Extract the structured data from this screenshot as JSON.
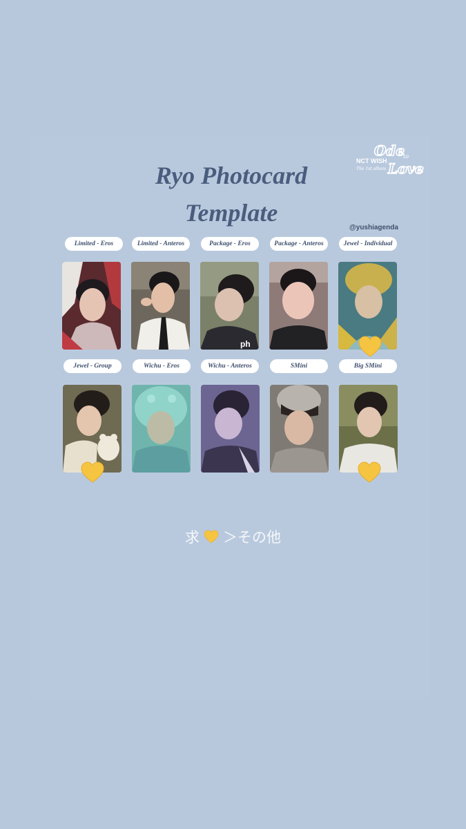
{
  "title_line1": "Ryo Photocard",
  "title_line2": "Template",
  "handle": "@yushiagenda",
  "logo": {
    "text_main": "Ode to Love",
    "text_sub": "NCT WISH",
    "text_sub2": "The 1st album"
  },
  "row1": [
    {
      "label": "Limited - Eros",
      "photo": "portrait-red-hood",
      "heart": false
    },
    {
      "label": "Limited - Anteros",
      "photo": "portrait-white-shirt-tie",
      "heart": false
    },
    {
      "label": "Package - Eros",
      "photo": "portrait-closeup-green",
      "heart": false
    },
    {
      "label": "Package - Anteros",
      "photo": "portrait-black-top",
      "heart": false
    },
    {
      "label": "Jewel - Individual",
      "photo": "portrait-yellow-hat",
      "heart": true
    }
  ],
  "row2": [
    {
      "label": "Jewel - Group",
      "photo": "portrait-with-bear",
      "heart": true
    },
    {
      "label": "Wichu - Eros",
      "photo": "portrait-teal-hood",
      "heart": false
    },
    {
      "label": "Wichu - Anteros",
      "photo": "portrait-purple-dark",
      "heart": false
    },
    {
      "label": "SMini",
      "photo": "portrait-grey-beanie",
      "heart": false
    },
    {
      "label": "Big SMini",
      "photo": "portrait-outdoor",
      "heart": true
    }
  ],
  "caption_left": "求",
  "caption_right": "＞その他",
  "colors": {
    "background": "#b7c8dc",
    "title": "#4a5d7e",
    "heart": "#f5c542"
  }
}
